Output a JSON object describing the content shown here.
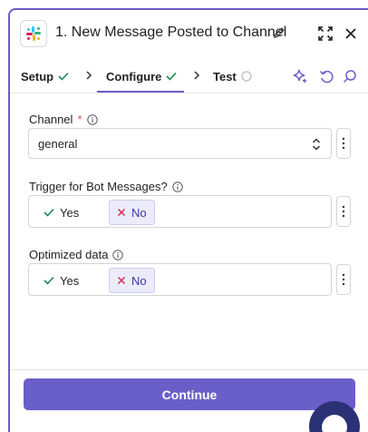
{
  "header": {
    "title": "1. New Message Posted to Channel",
    "app_icon": "slack-logo",
    "pencil_icon": "pencil-icon",
    "expand_icon": "expand-icon",
    "close_icon": "close-icon"
  },
  "tabs": [
    {
      "label": "Setup",
      "status": "done"
    },
    {
      "label": "Configure",
      "status": "done",
      "active": true
    },
    {
      "label": "Test",
      "status": "pending"
    }
  ],
  "toolbar": {
    "icons": [
      "sparkle-icon",
      "undo-icon",
      "search-icon"
    ]
  },
  "fields": {
    "channel": {
      "label": "Channel",
      "required_mark": "*",
      "value": "general"
    },
    "trigger_bot": {
      "label": "Trigger for Bot Messages?",
      "yes": "Yes",
      "no": "No",
      "selected": "No"
    },
    "optimized": {
      "label": "Optimized data",
      "yes": "Yes",
      "no": "No",
      "selected": "No"
    }
  },
  "footer": {
    "continue_label": "Continue"
  },
  "colors": {
    "accent": "#6a5ec9",
    "check": "#1f8a52",
    "no_x": "#d6304c",
    "required": "#e0533b"
  }
}
